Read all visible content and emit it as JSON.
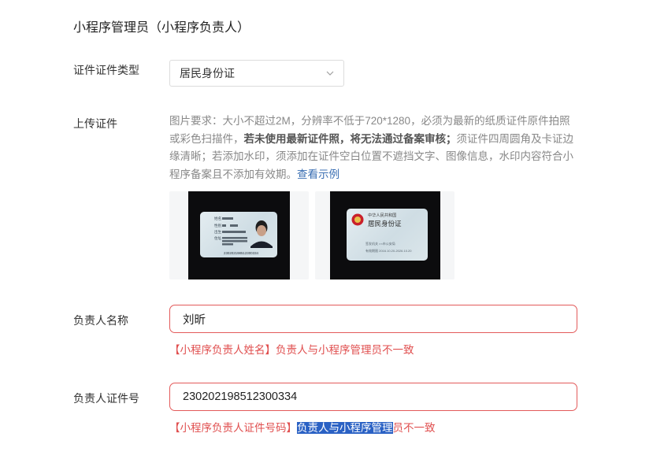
{
  "section": {
    "title": "小程序管理员（小程序负责人）"
  },
  "cert_type": {
    "label": "证件证件类型",
    "value": "居民身份证"
  },
  "upload": {
    "label": "上传证件",
    "req_part1": "图片要求：大小不超过2M，分辨率不低于720*1280，必须为最新的纸质证件原件拍照或彩色扫描件，",
    "req_bold": "若未使用最新证件照，将无法通过备案审核；",
    "req_part2": "须证件四周圆角及卡证边缘清晰；若添加水印，须添加在证件空白位置不遮挡文字、图像信息，水印内容符合小程序备案且不添加有效期。",
    "req_link": "查看示例",
    "front_card": {
      "name_lines": [
        "姓名",
        "性别",
        "出生",
        "住址"
      ],
      "id_number": "230202198512300334"
    },
    "back_card": {
      "country": "中华人民共和国",
      "title": "居民身份证",
      "authority_line": "签发机关  ××市公安局",
      "validity_line": "有效期限  2016.10.20-2026.10.20"
    }
  },
  "person_name": {
    "label": "负责人名称",
    "value": "刘昕",
    "error": "【小程序负责人姓名】负责人与小程序管理员不一致"
  },
  "person_id": {
    "label": "负责人证件号",
    "value": "230202198512300334",
    "error_prefix": "【小程序负责人证件号码】",
    "error_selected": "负责人与小程序管理",
    "error_suffix": "员不一致"
  },
  "colors": {
    "error": "#e04f4f",
    "error_border": "#e35a5a",
    "link": "#3b6fb3",
    "selection": "#2a61c4"
  }
}
